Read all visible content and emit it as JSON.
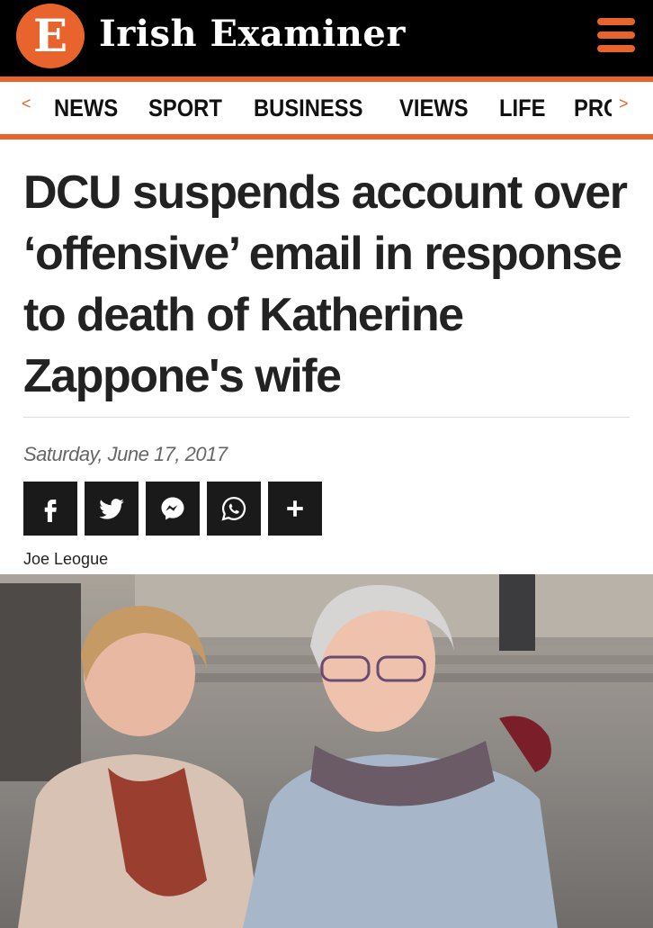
{
  "header": {
    "logo_letter": "E",
    "brand": "Irish Examiner",
    "accent_color": "#e8642c",
    "menu_icon": "hamburger-menu-icon"
  },
  "nav": {
    "prev_arrow": "<",
    "next_arrow": ">",
    "items": [
      "NEWS",
      "SPORT",
      "BUSINESS",
      "VIEWS",
      "LIFE",
      "PROPERTY"
    ]
  },
  "article": {
    "headline": "DCU suspends account over ‘offensive’ email in response to death of Katherine Zappone's wife",
    "date": "Saturday, June 17, 2017",
    "author": "Joe Leogue",
    "share_buttons": [
      "facebook-icon",
      "twitter-icon",
      "messenger-icon",
      "whatsapp-icon",
      "plus-icon"
    ]
  }
}
